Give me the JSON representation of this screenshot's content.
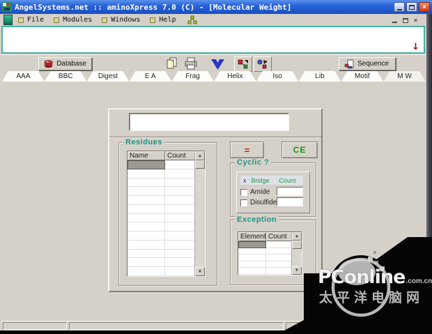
{
  "window": {
    "title": "AngelSystems.net :: aminoXpress 7.0 (C) - [Molecular Weight]"
  },
  "icons": {
    "close_glyph": "×",
    "scroll_up": "▲",
    "scroll_down": "▼",
    "red_arrow": "↓",
    "mdi_close_glyph": "×"
  },
  "menu": {
    "items": [
      "File",
      "Modules",
      "Windows",
      "Help"
    ]
  },
  "toolbar": {
    "database": "Database",
    "sequence": "Sequence"
  },
  "tabs": {
    "labels": [
      "AAA",
      "BBC",
      "Digest",
      "E A",
      "Frag",
      "Helix",
      "Iso",
      "Lib",
      "Motif",
      "M W"
    ],
    "active": "M W"
  },
  "main": {
    "formula_input": {
      "value": "",
      "placeholder": ""
    },
    "residues": {
      "title": "Residues",
      "columns": [
        "Name",
        "Count"
      ],
      "row_count": 13,
      "selected_cell": "row 1 / Name"
    },
    "equals_button": "=",
    "ce_button": "CE",
    "cyclic": {
      "title": "Cyclic ?",
      "header": [
        "x",
        "Bridge",
        "Count"
      ],
      "options": [
        {
          "label": "Amide",
          "checked": false,
          "count": ""
        },
        {
          "label": "Disulfide",
          "checked": false,
          "count": ""
        }
      ]
    },
    "exception": {
      "title": "Exception",
      "columns": [
        "Element",
        "Count"
      ],
      "row_count": 5,
      "selected_cell": "row 1 / Element"
    }
  },
  "statusbar": {
    "segments": [
      "",
      "",
      ""
    ]
  },
  "watermark": {
    "brand": "PConline",
    "suffix": ".com.cn",
    "tagline": "太平洋电脑网"
  },
  "colors": {
    "titlebar_blue": "#2a63d8",
    "teal_label": "#1e9488",
    "green_text": "#149414",
    "red_text": "#cc1111",
    "seqbox_border": "#49b1a6",
    "close_button_red": "#cf3a17",
    "watermark_bg": "#000000"
  }
}
